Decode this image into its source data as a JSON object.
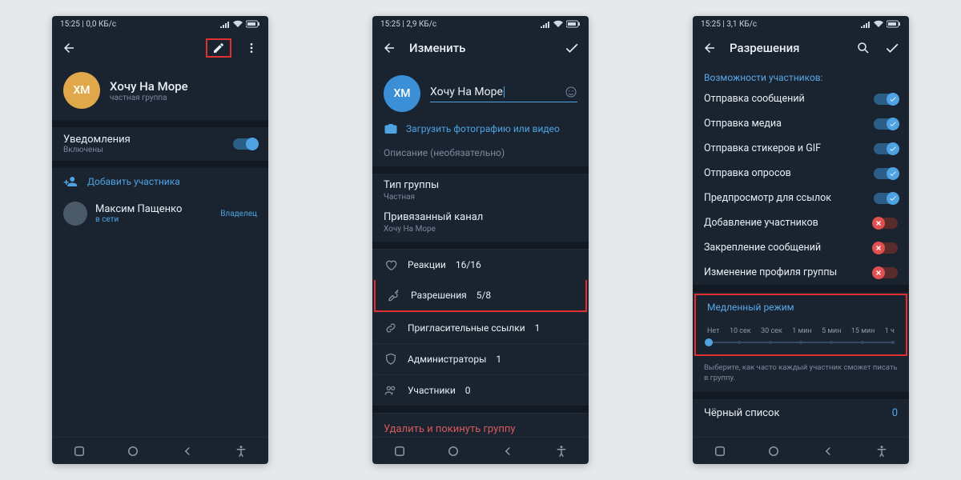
{
  "status": {
    "time": "15:25",
    "net1": "0,0 КБ/с",
    "net2": "2,9 КБ/с",
    "net3": "3,1 КБ/с"
  },
  "screen1": {
    "group_name": "Хочу На Море",
    "group_subtitle": "частная группа",
    "avatar_initials": "ХМ",
    "notifications_label": "Уведомления",
    "notifications_status": "Включены",
    "add_member": "Добавить участника",
    "member_name": "Максим Пащенко",
    "member_status": "в сети",
    "owner_label": "Владелец"
  },
  "screen2": {
    "title": "Изменить",
    "avatar_initials": "ХМ",
    "name_value": "Хочу На Море",
    "upload_label": "Загрузить фотографию или видео",
    "description_placeholder": "Описание (необязательно)",
    "group_type_label": "Тип группы",
    "group_type_value": "Частная",
    "linked_channel_label": "Привязанный канал",
    "linked_channel_value": "Хочу На Море",
    "reactions_label": "Реакции",
    "reactions_value": "16/16",
    "permissions_label": "Разрешения",
    "permissions_value": "5/8",
    "invite_links_label": "Пригласительные ссылки",
    "invite_links_value": "1",
    "admins_label": "Администраторы",
    "admins_value": "1",
    "members_label": "Участники",
    "members_value": "0",
    "delete_label": "Удалить и покинуть группу"
  },
  "screen3": {
    "title": "Разрешения",
    "section_header": "Возможности участников:",
    "perms": [
      {
        "label": "Отправка сообщений",
        "on": true
      },
      {
        "label": "Отправка медиа",
        "on": true
      },
      {
        "label": "Отправка стикеров и GIF",
        "on": true
      },
      {
        "label": "Отправка опросов",
        "on": true
      },
      {
        "label": "Предпросмотр для ссылок",
        "on": true
      },
      {
        "label": "Добавление участников",
        "on": false
      },
      {
        "label": "Закрепление сообщений",
        "on": false
      },
      {
        "label": "Изменение профиля группы",
        "on": false
      }
    ],
    "slowmode_header": "Медленный режим",
    "slowmode_steps": [
      "Нет",
      "10 сек",
      "30 сек",
      "1 мин",
      "5 мин",
      "15 мин",
      "1 ч"
    ],
    "slowmode_hint": "Выберите, как часто каждый участник сможет писать в группу.",
    "blacklist_label": "Чёрный список",
    "blacklist_count": "0"
  }
}
